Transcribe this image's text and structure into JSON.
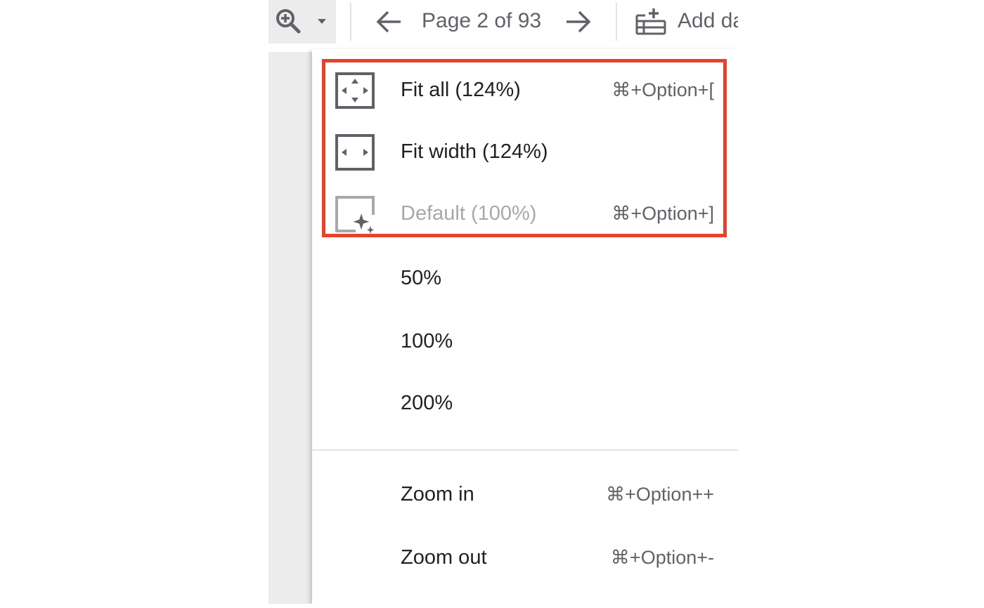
{
  "toolbar": {
    "page_indicator": "Page 2 of 93",
    "add_data_label": "Add da",
    "icons": {
      "zoom": "zoom-in-icon",
      "dropdown": "caret-down-icon",
      "prev": "arrow-left-icon",
      "next": "arrow-right-icon",
      "add_data": "add-data-icon"
    }
  },
  "zoom_menu": {
    "items": [
      {
        "label": "Fit all (124%)",
        "shortcut": "⌘+Option+[",
        "icon": "fit-all-icon",
        "enabled": true
      },
      {
        "label": "Fit width (124%)",
        "shortcut": "",
        "icon": "fit-width-icon",
        "enabled": true
      },
      {
        "label": "Default (100%)",
        "shortcut": "⌘+Option+]",
        "icon": "default-zoom-icon",
        "enabled": false
      },
      {
        "label": "50%",
        "shortcut": "",
        "enabled": true
      },
      {
        "label": "100%",
        "shortcut": "",
        "enabled": true
      },
      {
        "label": "200%",
        "shortcut": "",
        "enabled": true
      },
      {
        "label": "Zoom in",
        "shortcut": "⌘+Option++",
        "enabled": true
      },
      {
        "label": "Zoom out",
        "shortcut": "⌘+Option+-",
        "enabled": true
      }
    ]
  },
  "colors": {
    "highlight": "#e8432a",
    "icon_gray": "#5f6368",
    "disabled_text": "#a8a8a8",
    "panel_gray": "#ececec"
  }
}
